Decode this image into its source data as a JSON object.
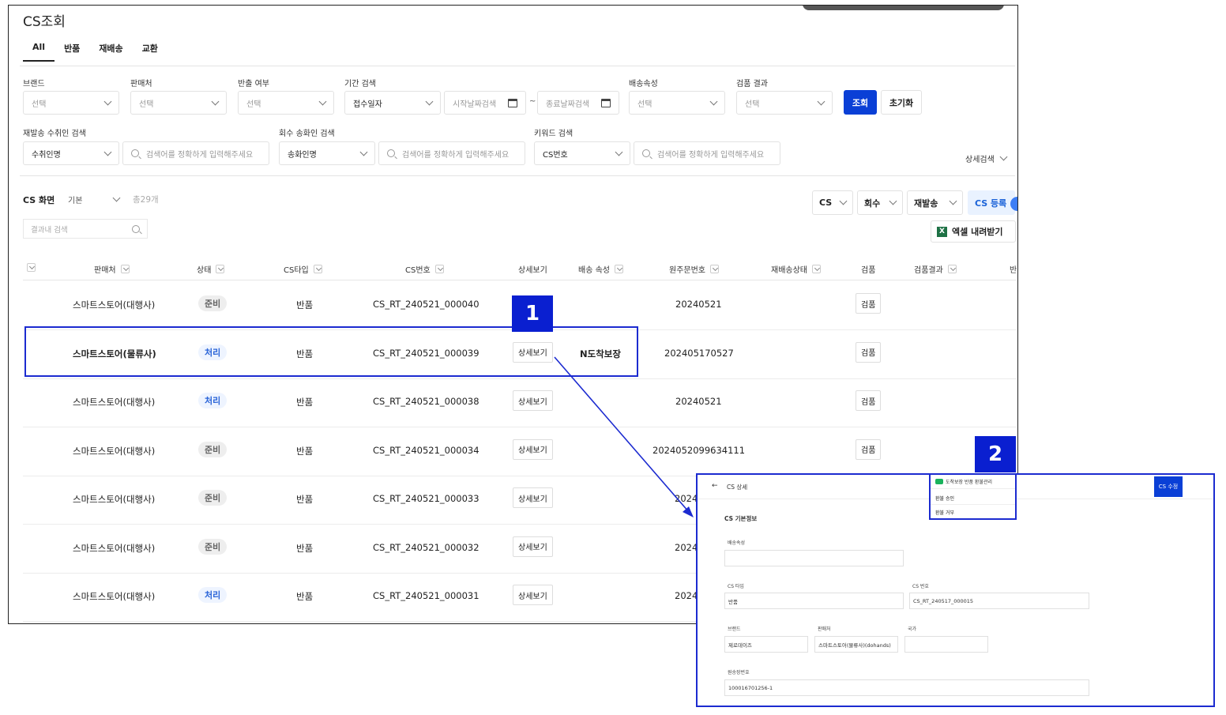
{
  "page": {
    "title": "CS조회",
    "tabs": [
      "All",
      "반품",
      "재배송",
      "교환"
    ]
  },
  "filters": {
    "brand": {
      "label": "브랜드",
      "placeholder": "선택"
    },
    "seller": {
      "label": "판매처",
      "placeholder": "선택"
    },
    "return_flag": {
      "label": "반출 여부",
      "placeholder": "선택"
    },
    "period": {
      "label": "기간 검색",
      "type": "접수일자",
      "start": "시작날짜검색",
      "sep": "~",
      "end": "종료날짜검색"
    },
    "delivery": {
      "label": "배송속성",
      "placeholder": "선택"
    },
    "inspection": {
      "label": "검품 결과",
      "placeholder": "선택"
    },
    "search_button": "조회",
    "reset_button": "초기화",
    "resend_receiver": {
      "label": "재발송 수취인 검색",
      "type": "수취인명",
      "placeholder": "검색어를 정확하게 입력해주세요"
    },
    "pickup_sender": {
      "label": "회수 송화인 검색",
      "type": "송화인명",
      "placeholder": "검색어를 정확하게 입력해주세요"
    },
    "keyword": {
      "label": "키워드 검색",
      "type": "CS번호",
      "placeholder": "검색어를 정확하게 입력해주세요"
    },
    "detail_search": "상세검색"
  },
  "list": {
    "section_title": "CS 화면",
    "view": "기본",
    "total": "총29개",
    "result_search": "결과내 검색",
    "buttons": {
      "cs": "CS",
      "pickup": "회수",
      "resend": "재발송",
      "register": "CS 등록",
      "excel": "엑셀 내려받기",
      "excel_icon": "X"
    },
    "columns": [
      "판매처",
      "상태",
      "CS타입",
      "CS번호",
      "상세보기",
      "배송 속성",
      "원주문번호",
      "재배송상태",
      "검품",
      "검품결과",
      "반"
    ],
    "rows": [
      {
        "seller": "스마트스토어(대행사)",
        "status": "준비",
        "status_color": "gray",
        "type": "반품",
        "cs_no": "CS_RT_240521_000040",
        "detail": "",
        "delivery": "",
        "order_no": "20240521",
        "inspect": "검품"
      },
      {
        "seller": "스마트스토어(물류사)",
        "status": "처리",
        "status_color": "blue",
        "type": "반품",
        "cs_no": "CS_RT_240521_000039",
        "detail": "상세보기",
        "delivery": "N도착보장",
        "order_no": "202405170527",
        "inspect": "검품"
      },
      {
        "seller": "스마트스토어(대행사)",
        "status": "처리",
        "status_color": "blue",
        "type": "반품",
        "cs_no": "CS_RT_240521_000038",
        "detail": "상세보기",
        "delivery": "",
        "order_no": "20240521",
        "inspect": "검품"
      },
      {
        "seller": "스마트스토어(대행사)",
        "status": "준비",
        "status_color": "gray",
        "type": "반품",
        "cs_no": "CS_RT_240521_000034",
        "detail": "상세보기",
        "delivery": "",
        "order_no": "2024052099634111",
        "inspect": "검품"
      },
      {
        "seller": "스마트스토어(대행사)",
        "status": "준비",
        "status_color": "gray",
        "type": "반품",
        "cs_no": "CS_RT_240521_000033",
        "detail": "상세보기",
        "delivery": "",
        "order_no": "2024",
        "inspect": ""
      },
      {
        "seller": "스마트스토어(대행사)",
        "status": "준비",
        "status_color": "gray",
        "type": "반품",
        "cs_no": "CS_RT_240521_000032",
        "detail": "상세보기",
        "delivery": "",
        "order_no": "2024",
        "inspect": ""
      },
      {
        "seller": "스마트스토어(대행사)",
        "status": "처리",
        "status_color": "blue",
        "type": "반품",
        "cs_no": "CS_RT_240521_000031",
        "detail": "상세보기",
        "delivery": "",
        "order_no": "2024",
        "inspect": ""
      }
    ]
  },
  "annotations": {
    "one": "1",
    "two": "2"
  },
  "popup": {
    "back": "←",
    "title": "CS 상세",
    "section": "CS 기본정보",
    "edit": "CS 수정",
    "menu_title": "도착보장 반품 환불관리",
    "menu_items": [
      "환불 승인",
      "환불 거부"
    ],
    "fields": {
      "delivery_label": "배송속성",
      "delivery_value": "",
      "type_label": "CS 타입",
      "type_value": "반품",
      "cs_no_label": "CS 번호",
      "cs_no_value": "CS_RT_240517_000015",
      "brand_label": "브랜드",
      "brand_value": "제로데이즈",
      "seller_label": "판매처",
      "seller_value": "스마트스토어(물류사)(dohands)",
      "country_label": "국가",
      "country_value": "",
      "origin_label": "원송장번호",
      "origin_value": "100016701256-1"
    }
  }
}
